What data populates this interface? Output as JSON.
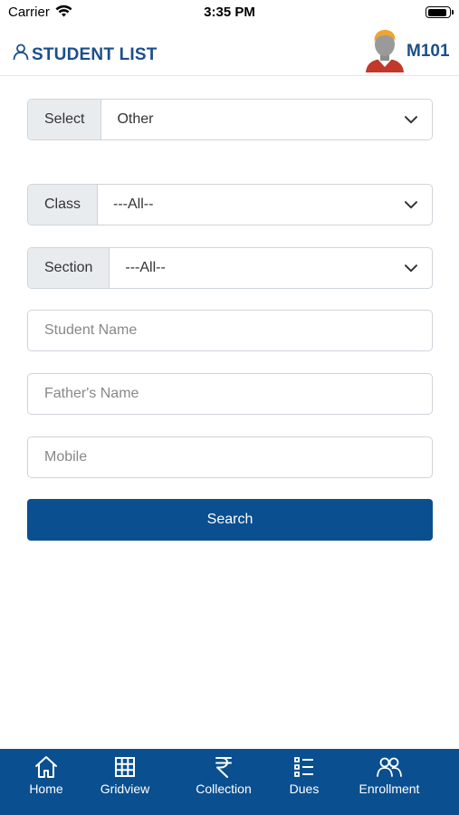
{
  "status_bar": {
    "carrier": "Carrier",
    "time": "3:35 PM",
    "battery_level": 0.9
  },
  "header": {
    "title": "STUDENT LIST",
    "user_code": "M101"
  },
  "form": {
    "select": {
      "label": "Select",
      "value": "Other"
    },
    "class": {
      "label": "Class",
      "value": "---All--"
    },
    "section": {
      "label": "Section",
      "value": "---All--"
    },
    "student_name_placeholder": "Student Name",
    "father_name_placeholder": "Father's Name",
    "mobile_placeholder": "Mobile",
    "search_label": "Search"
  },
  "bottom_nav": {
    "items": [
      {
        "label": "Home",
        "icon": "home-icon"
      },
      {
        "label": "Gridview",
        "icon": "grid-icon"
      },
      {
        "label": "Collection",
        "icon": "rupee-icon"
      },
      {
        "label": "Dues",
        "icon": "list-icon"
      },
      {
        "label": "Enrollment",
        "icon": "users-icon"
      }
    ]
  },
  "colors": {
    "primary": "#0a4f8f",
    "title": "#1b4f8c",
    "label_bg": "#e9ecef"
  }
}
